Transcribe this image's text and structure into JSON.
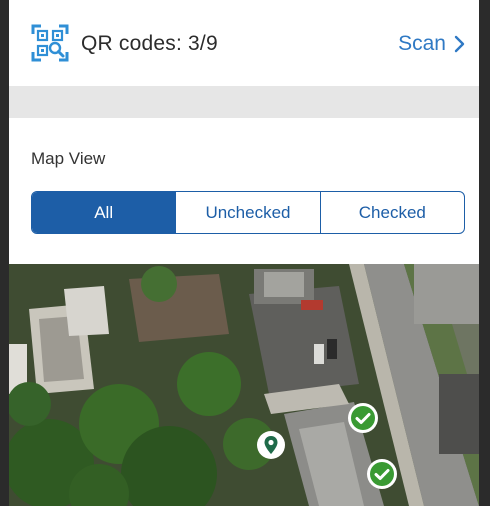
{
  "header": {
    "title": "QR codes: 3/9",
    "scan_label": "Scan",
    "qr_icon": "qr-scan-icon",
    "scan_icon": "chevron-right-icon"
  },
  "map_view": {
    "label": "Map View",
    "options": [
      {
        "label": "All",
        "selected": true
      },
      {
        "label": "Unchecked",
        "selected": false
      },
      {
        "label": "Checked",
        "selected": false
      }
    ]
  },
  "map": {
    "markers": [
      {
        "type": "location-pin",
        "color": "#1f6b4a"
      },
      {
        "type": "check",
        "color": "#3a9a33"
      },
      {
        "type": "check",
        "color": "#3a9a33"
      }
    ]
  },
  "colors": {
    "accent": "#1d5ea7",
    "link": "#2f79c4",
    "check": "#3a9a33",
    "pin": "#1f6b4a",
    "band": "#e6e6e6"
  }
}
